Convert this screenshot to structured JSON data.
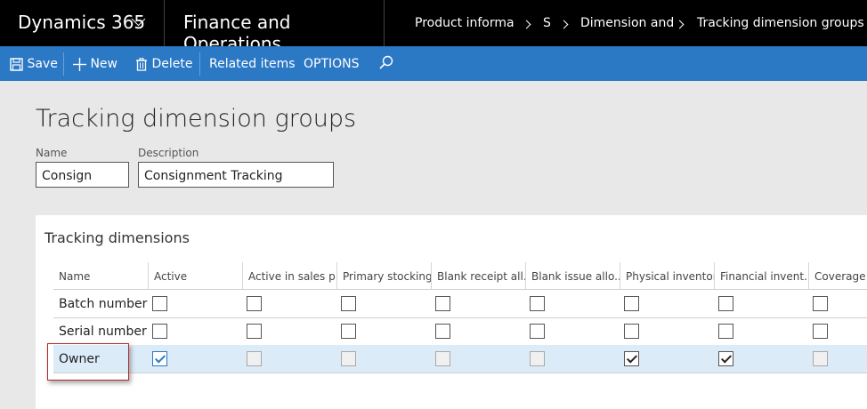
{
  "nav": {
    "brand": "Dynamics 365",
    "module": "Finance and Operations",
    "breadcrumbs": [
      "Product informatic",
      "S",
      "Dimension and",
      "Tracking dimension groups"
    ]
  },
  "toolbar": {
    "save": "Save",
    "new": "New",
    "delete": "Delete",
    "related": "Related items",
    "options": "OPTIONS"
  },
  "page": {
    "title": "Tracking dimension groups",
    "name_label": "Name",
    "name_value": "Consign",
    "description_label": "Description",
    "description_value": "Consignment Tracking"
  },
  "tracking": {
    "section_title": "Tracking dimensions",
    "columns": [
      "Name",
      "Active",
      "Active in sales p...",
      "Primary stocking",
      "Blank receipt all...",
      "Blank issue allo...",
      "Physical inventory",
      "Financial invent...",
      "Coverage p"
    ],
    "rows": [
      {
        "name": "Batch number",
        "checks": [
          false,
          false,
          false,
          false,
          false,
          false,
          false,
          false
        ],
        "selected": false
      },
      {
        "name": "Serial number",
        "checks": [
          false,
          false,
          false,
          false,
          false,
          false,
          false,
          false
        ],
        "selected": false
      },
      {
        "name": "Owner",
        "checks": [
          true,
          false,
          false,
          false,
          false,
          true,
          true,
          false
        ],
        "selected": true
      }
    ]
  },
  "colors": {
    "toolbar": "#2b78c5",
    "nav": "#000000",
    "selected_row": "#dcebf8",
    "highlight_box": "#b52828"
  }
}
